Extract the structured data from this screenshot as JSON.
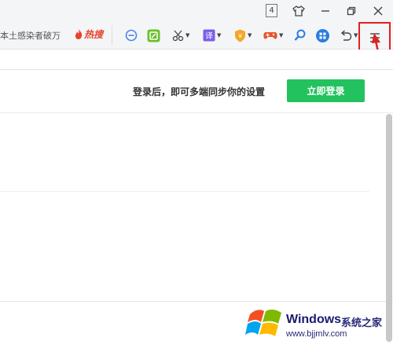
{
  "titlebar": {
    "tab_count": "4",
    "icons": [
      "shirt-icon",
      "minimize-icon",
      "restore-icon",
      "close-icon"
    ]
  },
  "toolbar": {
    "search_text": "本土感染者破万",
    "hot_label": "热搜",
    "icons": [
      "minus-circle-icon",
      "screenshot-icon",
      "scissors-icon",
      "translate-icon",
      "shield-icon",
      "game-icon",
      "search-icon",
      "apps-icon",
      "undo-icon",
      "menu-icon"
    ]
  },
  "sync": {
    "message": "登录后，即可多端同步你的设置",
    "login_label": "立即登录"
  },
  "colors": {
    "login_green": "#22c25e",
    "highlight_red": "#e02020",
    "hot_red": "#e8432b"
  },
  "watermark": {
    "brand": "Windows",
    "cn": "系统之家",
    "url": "www.bjjmlv.com"
  }
}
